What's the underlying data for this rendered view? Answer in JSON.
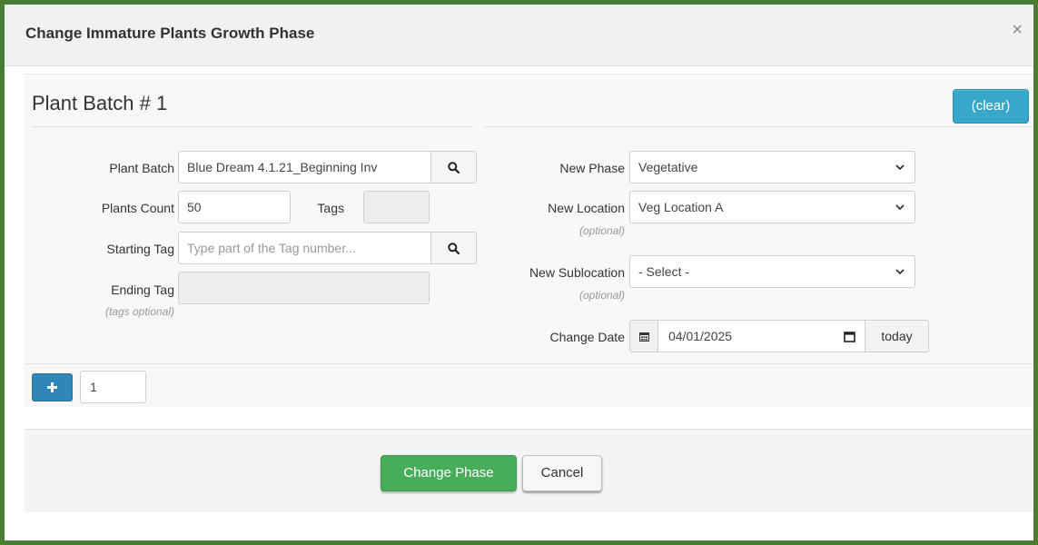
{
  "modal": {
    "title": "Change Immature Plants Growth Phase",
    "close_symbol": "×"
  },
  "batch": {
    "heading": "Plant Batch # 1",
    "clear_label": "(clear)"
  },
  "left_form": {
    "plant_batch_label": "Plant Batch",
    "plant_batch_value": "Blue Dream 4.1.21_Beginning Inv",
    "plants_count_label": "Plants Count",
    "plants_count_value": "50",
    "tags_label": "Tags",
    "tags_value": "",
    "starting_tag_label": "Starting Tag",
    "starting_tag_placeholder": "Type part of the Tag number...",
    "ending_tag_label": "Ending Tag",
    "ending_tag_value": "",
    "tags_optional_note": "(tags optional)"
  },
  "right_form": {
    "new_phase_label": "New Phase",
    "new_phase_value": "Vegetative",
    "new_location_label": "New Location",
    "new_location_value": "Veg Location A",
    "new_location_note": "(optional)",
    "new_sublocation_label": "New Sublocation",
    "new_sublocation_value": "- Select -",
    "new_sublocation_note": "(optional)",
    "change_date_label": "Change Date",
    "change_date_value": "04/01/2025",
    "today_label": "today"
  },
  "batch_count": {
    "value": "1"
  },
  "footer": {
    "primary_label": "Change Phase",
    "cancel_label": "Cancel"
  },
  "icons": {
    "close": "close-icon",
    "search": "search-icon",
    "chevron": "chevron-down-icon",
    "calendar": "calendar-icon",
    "plus": "plus-icon"
  },
  "colors": {
    "frame_border": "#4a7c36",
    "clear_button": "#37a8c9",
    "plus_button": "#2f87b8",
    "primary_button": "#48ad5b"
  }
}
